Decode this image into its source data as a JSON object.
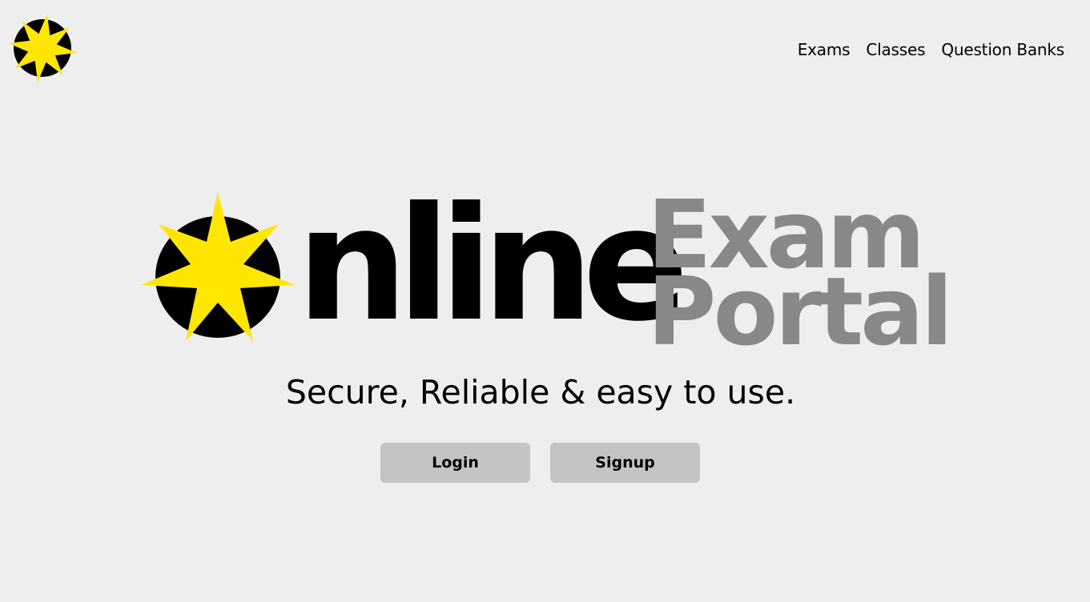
{
  "nav": {
    "items": [
      {
        "label": "Exams"
      },
      {
        "label": "Classes"
      },
      {
        "label": "Question Banks"
      }
    ]
  },
  "hero": {
    "word_online": "nline",
    "word_exam": "Exam",
    "word_portal": "Portal",
    "tagline": "Secure, Reliable & easy to use."
  },
  "actions": {
    "login_label": "Login",
    "signup_label": "Signup"
  },
  "colors": {
    "background": "#eeeeee",
    "star_yellow": "#ffe600",
    "logo_black": "#000000",
    "secondary_gray": "#888888",
    "button_gray": "#c4c4c4"
  },
  "icons": {
    "logo": "star-in-circle-icon"
  }
}
